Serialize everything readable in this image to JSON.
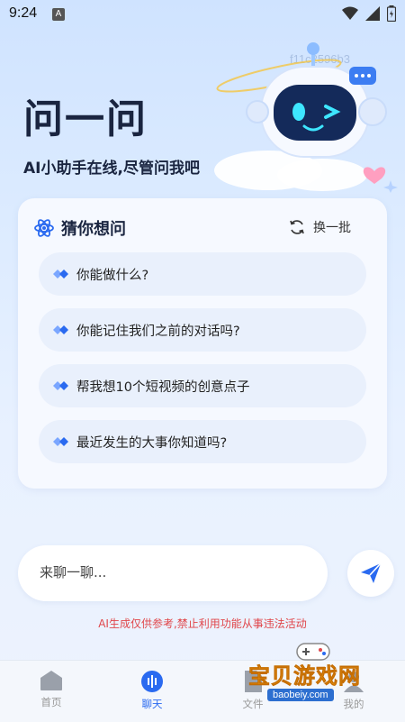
{
  "status_bar": {
    "time": "9:24",
    "notif_letter": "A"
  },
  "hero": {
    "title": "问一问",
    "subtitle": "AI小助手在线,尽管问我吧",
    "id_text": "f11c2596b3"
  },
  "suggestions": {
    "title": "猜你想问",
    "refresh_label": "换一批",
    "items": [
      "你能做什么?",
      "你能记住我们之前的对话吗?",
      "帮我想10个短视频的创意点子",
      "最近发生的大事你知道吗?"
    ]
  },
  "input": {
    "placeholder": "来聊一聊..."
  },
  "disclaimer": "AI生成仅供参考,禁止利用功能从事违法活动",
  "tabs": [
    {
      "label": "首页",
      "icon": "home-icon",
      "active": false
    },
    {
      "label": "聊天",
      "icon": "chat-voice-icon",
      "active": true
    },
    {
      "label": "文件",
      "icon": "file-icon",
      "active": false
    },
    {
      "label": "我的",
      "icon": "profile-icon",
      "active": false
    }
  ],
  "watermark": {
    "name": "宝贝游戏网",
    "url": "baobeiy.com"
  },
  "colors": {
    "accent": "#2a6af0",
    "warning": "#e0464b",
    "title": "#1a2540"
  }
}
